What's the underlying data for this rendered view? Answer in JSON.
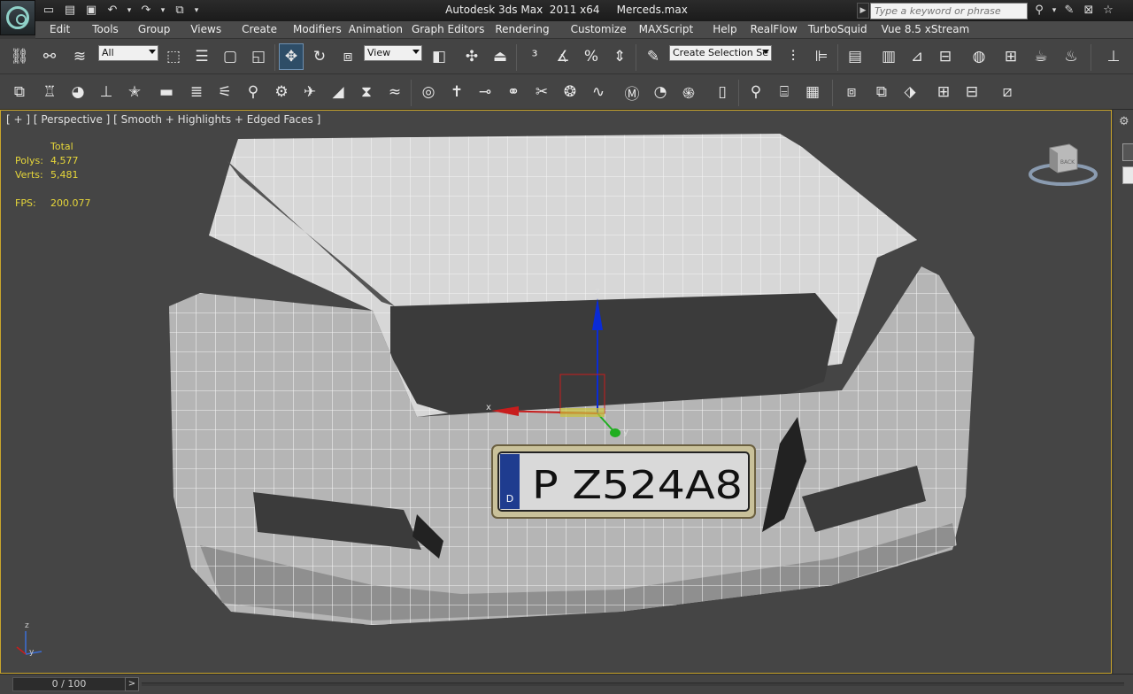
{
  "window": {
    "title": "Autodesk 3ds Max  2011 x64     Merceds.max",
    "search_placeholder": "Type a keyword or phrase"
  },
  "menu": [
    "Edit",
    "Tools",
    "Group",
    "Views",
    "Create",
    "Modifiers",
    "Animation",
    "Graph Editors",
    "Rendering",
    "Customize",
    "MAXScript",
    "Help",
    "RealFlow",
    "TurboSquid",
    "Vue 8.5 xStream"
  ],
  "toolbar": {
    "selection_filter": "All",
    "ref_coord": "View",
    "named_selection": "Create Selection Se"
  },
  "viewport": {
    "label": "[ + ] [ Perspective ] [ Smooth + Highlights + Edged Faces ]",
    "stats": {
      "total_label": "Total",
      "polys_label": "Polys:",
      "polys_value": "4,577",
      "verts_label": "Verts:",
      "verts_value": "5,481",
      "fps_label": "FPS:",
      "fps_value": "200.077"
    },
    "gizmo_labels": {
      "z": "z",
      "x": "x",
      "y": "y"
    },
    "viewcube_label": "BACK",
    "plate_text": "P Z524A8",
    "plate_country": "D"
  },
  "timeline": {
    "frame": "0 / 100",
    "next": ">"
  },
  "colors": {
    "viewport_border": "#c9a52b",
    "stats_text": "#e6d63a"
  }
}
